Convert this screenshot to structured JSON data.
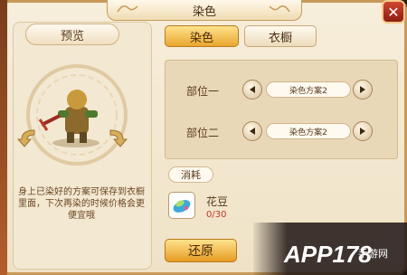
{
  "window": {
    "title": "染色",
    "close_label": "✕"
  },
  "preview": {
    "tab_label": "预览",
    "description": "身上已染好的方案可保存到衣橱里面，下次再染的时候价格会更便宜哦"
  },
  "tabs": {
    "dye_label": "染色",
    "wardrobe_label": "衣橱"
  },
  "parts": [
    {
      "label": "部位一",
      "scheme": "染色方案2"
    },
    {
      "label": "部位二",
      "scheme": "染色方案2"
    }
  ],
  "cost": {
    "label": "消耗",
    "item_name": "花豆",
    "item_count": "0/30"
  },
  "restore_label": "还原",
  "watermark": {
    "brand": "APP178",
    "sub": "手游网"
  },
  "colors": {
    "accent": "#e9a72f",
    "panel": "#f3e8d2",
    "close": "#c0392b"
  }
}
